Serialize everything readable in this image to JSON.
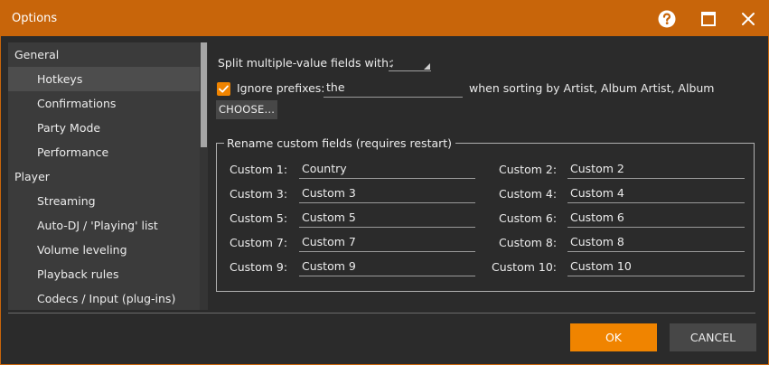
{
  "window": {
    "title": "Options"
  },
  "titlebar_icons": [
    "help-icon",
    "maximize-icon",
    "close-icon"
  ],
  "sidebar": {
    "items": [
      {
        "label": "General",
        "level": "top"
      },
      {
        "label": "Hotkeys",
        "level": "sub",
        "selected": true
      },
      {
        "label": "Confirmations",
        "level": "sub"
      },
      {
        "label": "Party Mode",
        "level": "sub"
      },
      {
        "label": "Performance",
        "level": "sub"
      },
      {
        "label": "Player",
        "level": "top"
      },
      {
        "label": "Streaming",
        "level": "sub"
      },
      {
        "label": "Auto-DJ / 'Playing' list",
        "level": "sub"
      },
      {
        "label": "Volume leveling",
        "level": "sub"
      },
      {
        "label": "Playback rules",
        "level": "sub"
      },
      {
        "label": "Codecs / Input (plug-ins)",
        "level": "sub"
      }
    ]
  },
  "main": {
    "split_label": "Split multiple-value fields with:",
    "split_value": ";",
    "ignore_checked": true,
    "ignore_label": "Ignore prefixes:",
    "ignore_value": "the",
    "sorting_label": "when sorting by Artist, Album Artist, Album",
    "choose_label": "CHOOSE...",
    "group_title": "Rename custom fields (requires restart)",
    "custom_fields": [
      {
        "label": "Custom 1:",
        "value": "Country"
      },
      {
        "label": "Custom 2:",
        "value": "Custom 2"
      },
      {
        "label": "Custom 3:",
        "value": "Custom 3"
      },
      {
        "label": "Custom 4:",
        "value": "Custom 4"
      },
      {
        "label": "Custom 5:",
        "value": "Custom 5"
      },
      {
        "label": "Custom 6:",
        "value": "Custom 6"
      },
      {
        "label": "Custom 7:",
        "value": "Custom 7"
      },
      {
        "label": "Custom 8:",
        "value": "Custom 8"
      },
      {
        "label": "Custom 9:",
        "value": "Custom 9"
      },
      {
        "label": "Custom 10:",
        "value": "Custom 10"
      }
    ]
  },
  "footer": {
    "ok_label": "OK",
    "cancel_label": "CANCEL"
  },
  "colors": {
    "accent": "#f08400",
    "titlebar": "#c8650a",
    "background": "#2b2b2b",
    "sidebar": "#3b3b3b",
    "selected": "#4d4d4d",
    "button": "#474747"
  }
}
